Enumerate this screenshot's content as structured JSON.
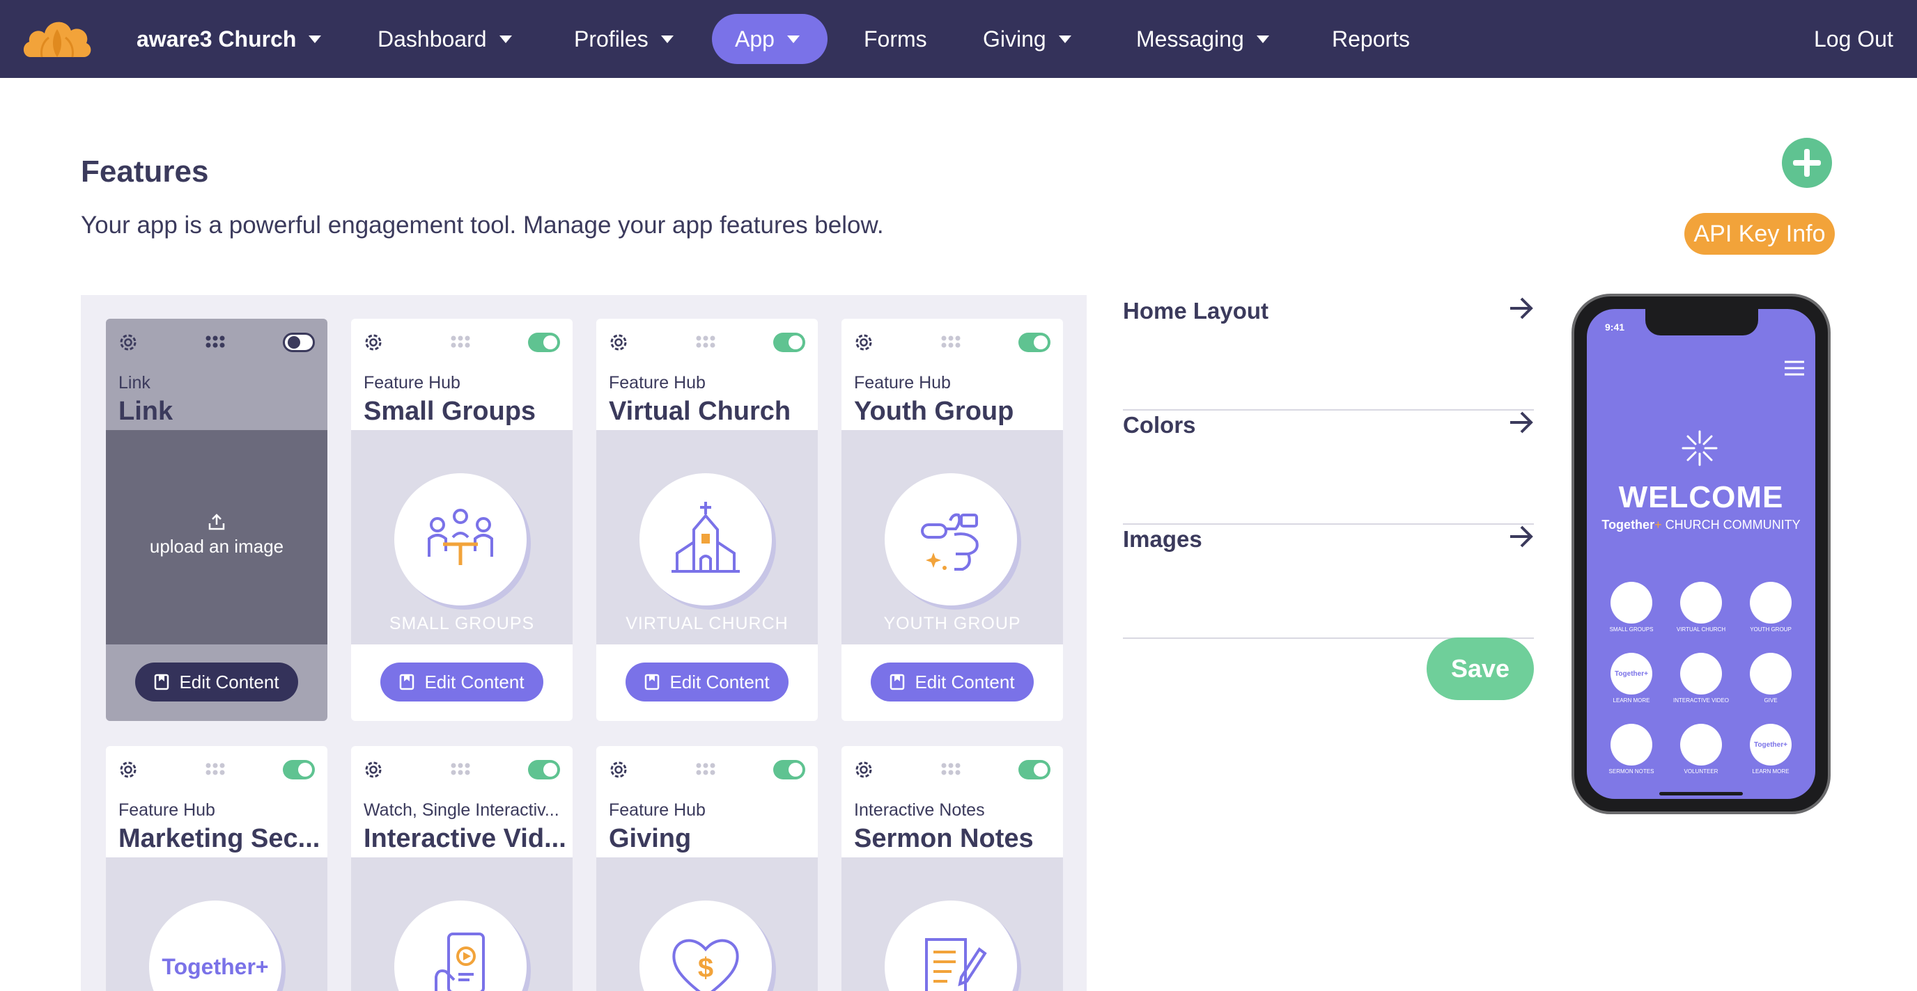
{
  "nav": {
    "items": [
      {
        "label": "aware3 Church",
        "dropdown": true
      },
      {
        "label": "Dashboard",
        "dropdown": true
      },
      {
        "label": "Profiles",
        "dropdown": true
      },
      {
        "label": "App",
        "dropdown": true,
        "active": true
      },
      {
        "label": "Forms",
        "dropdown": false
      },
      {
        "label": "Giving",
        "dropdown": true
      },
      {
        "label": "Messaging",
        "dropdown": true
      },
      {
        "label": "Reports",
        "dropdown": false
      }
    ],
    "logout": "Log Out",
    "logo_icon": "cloud-logo-icon"
  },
  "header": {
    "title": "Features",
    "subtitle": "Your app is a powerful engagement tool. Manage your app features below.",
    "add_icon": "plus-icon",
    "api_button": "API Key Info"
  },
  "cards": [
    {
      "type": "Link",
      "name": "Link",
      "enabled": false,
      "upload_label": "upload an image",
      "image_label": "",
      "edit_label": "Edit Content"
    },
    {
      "type": "Feature Hub",
      "name": "Small Groups",
      "enabled": true,
      "image_label": "SMALL GROUPS",
      "edit_label": "Edit Content",
      "icon": "small-groups-icon"
    },
    {
      "type": "Feature Hub",
      "name": "Virtual Church",
      "enabled": true,
      "image_label": "VIRTUAL CHURCH",
      "edit_label": "Edit Content",
      "icon": "church-icon"
    },
    {
      "type": "Feature Hub",
      "name": "Youth Group",
      "enabled": true,
      "image_label": "YOUTH GROUP",
      "edit_label": "Edit Content",
      "icon": "youth-group-icon"
    },
    {
      "type": "Feature Hub",
      "name": "Marketing Sec...",
      "enabled": true,
      "image_text": "Together+",
      "icon": "together-logo-icon"
    },
    {
      "type": "Watch, Single Interactiv...",
      "name": "Interactive Vid...",
      "enabled": true,
      "icon": "interactive-video-icon"
    },
    {
      "type": "Feature Hub",
      "name": "Giving",
      "enabled": true,
      "icon": "heart-dollar-icon"
    },
    {
      "type": "Interactive Notes",
      "name": "Sermon Notes",
      "enabled": true,
      "icon": "sermon-notes-icon"
    }
  ],
  "settings": {
    "rows": [
      {
        "label": "Home Layout"
      },
      {
        "label": "Colors"
      },
      {
        "label": "Images"
      }
    ],
    "save": "Save"
  },
  "phone": {
    "time": "9:41",
    "welcome": "WELCOME",
    "tagline_brand": "Together",
    "tagline_plus": "+",
    "tagline_rest": " CHURCH COMMUNITY",
    "tiles": [
      {
        "label": "SMALL GROUPS",
        "text": ""
      },
      {
        "label": "VIRTUAL CHURCH",
        "text": ""
      },
      {
        "label": "YOUTH GROUP",
        "text": ""
      },
      {
        "label": "LEARN MORE",
        "text": "Together+"
      },
      {
        "label": "INTERACTIVE VIDEO",
        "text": ""
      },
      {
        "label": "GIVE",
        "text": ""
      },
      {
        "label": "SERMON NOTES",
        "text": ""
      },
      {
        "label": "VOLUNTEER",
        "text": ""
      },
      {
        "label": "LEARN MORE",
        "text": "Together+"
      }
    ]
  },
  "colors": {
    "nav_bg": "#34325a",
    "accent": "#7a72e8",
    "green": "#5fc391",
    "orange": "#f2a33a"
  }
}
